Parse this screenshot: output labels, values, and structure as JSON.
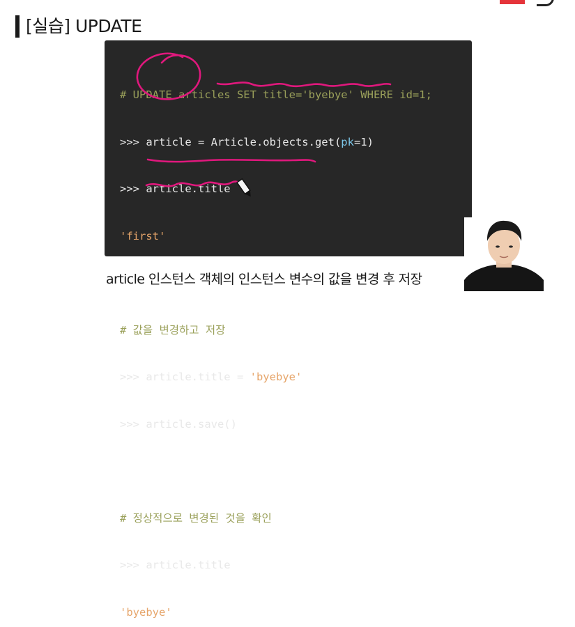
{
  "slide": {
    "title": "[실습] UPDATE",
    "caption": "article 인스턴스 객체의 인스턴스 변수의 값을 변경 후 저장"
  },
  "code": {
    "line1": "# UPDATE articles SET title='byebye' WHERE id=1;",
    "line2_prompt": ">>> ",
    "line2_a": "article = Article.objects.get(",
    "line2_param": "pk",
    "line2_b": "=1)",
    "line3": ">>> article.title",
    "line4": "'first'",
    "line6": "# 값을 변경하고 저장",
    "line7_prompt": ">>> ",
    "line7_a": "article.title = ",
    "line7_str": "'byebye'",
    "line8": ">>> article.save()",
    "line10": "# 정상적으로 변경된 것을 확인",
    "line11": ">>> article.title",
    "line12": "'byebye'"
  },
  "colors": {
    "panel_bg": "#272727",
    "comment": "#9aa05a",
    "string": "#e6a56a",
    "param": "#7cc6e8",
    "annotation": "#e0187d",
    "accent_red": "#e5343a"
  },
  "icons": {
    "pen_cursor": "pen-cursor-icon",
    "presenter": "webcam-presenter"
  }
}
